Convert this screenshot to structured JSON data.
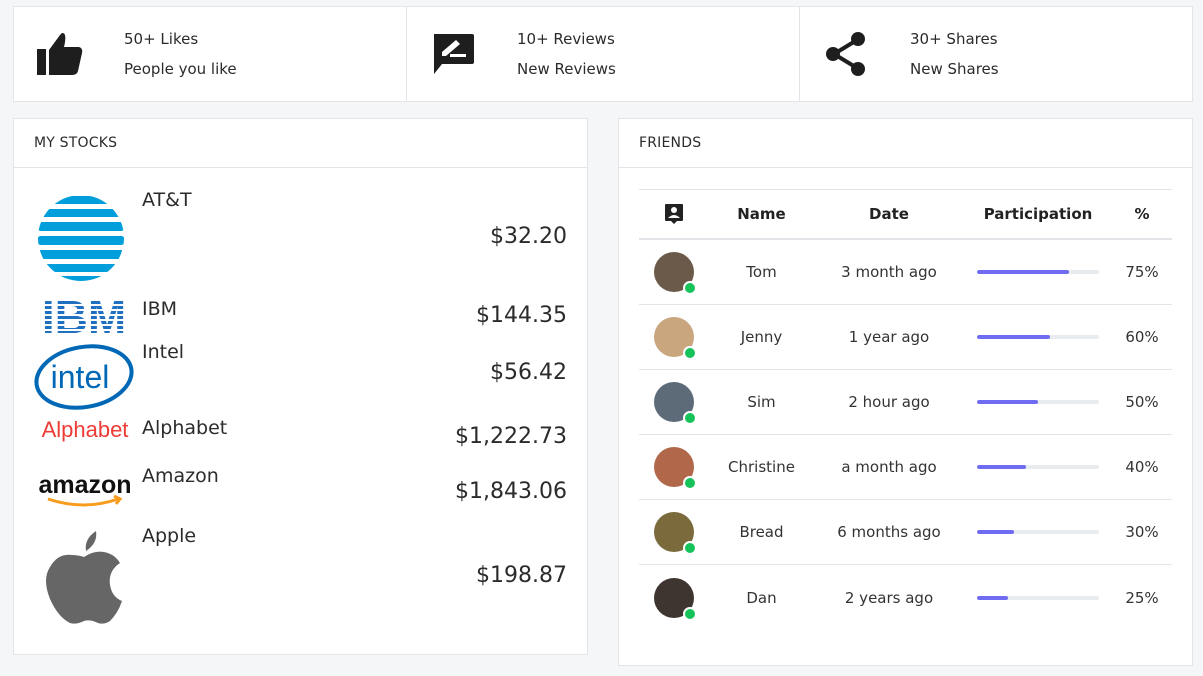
{
  "stats": [
    {
      "icon": "thumbs-up-icon",
      "title": "50+ Likes",
      "subtitle": "People you like"
    },
    {
      "icon": "review-icon",
      "title": "10+ Reviews",
      "subtitle": "New Reviews"
    },
    {
      "icon": "share-icon",
      "title": "30+ Shares",
      "subtitle": "New Shares"
    }
  ],
  "stocks": {
    "title": "MY STOCKS",
    "items": [
      {
        "name": "AT&T",
        "price": "$32.20",
        "logo": "att-logo",
        "logo_color": "#009fdb"
      },
      {
        "name": "IBM",
        "price": "$144.35",
        "logo": "ibm-logo",
        "logo_text": "IBM",
        "logo_color": "#1f70c1"
      },
      {
        "name": "Intel",
        "price": "$56.42",
        "logo": "intel-logo",
        "logo_text": "intel",
        "logo_color": "#0068b5"
      },
      {
        "name": "Alphabet",
        "price": "$1,222.73",
        "logo": "alphabet-logo",
        "logo_text": "Alphabet",
        "logo_color": "#ef3b36"
      },
      {
        "name": "Amazon",
        "price": "$1,843.06",
        "logo": "amazon-logo",
        "logo_text": "amazon",
        "logo_color": "#111111"
      },
      {
        "name": "Apple",
        "price": "$198.87",
        "logo": "apple-logo",
        "logo_color": "#666666"
      }
    ]
  },
  "friends": {
    "title": "FRIENDS",
    "headers": {
      "icon": "contact-icon",
      "name": "Name",
      "date": "Date",
      "participation": "Participation",
      "percent": "%"
    },
    "rows": [
      {
        "name": "Tom",
        "date": "3 month ago",
        "participation": 0.75,
        "percent": "75%",
        "avatar_color": "#6b5a4a"
      },
      {
        "name": "Jenny",
        "date": "1 year ago",
        "participation": 0.6,
        "percent": "60%",
        "avatar_color": "#c9a67e"
      },
      {
        "name": "Sim",
        "date": "2 hour ago",
        "participation": 0.5,
        "percent": "50%",
        "avatar_color": "#5d6b78"
      },
      {
        "name": "Christine",
        "date": "a month ago",
        "participation": 0.4,
        "percent": "40%",
        "avatar_color": "#b0674a"
      },
      {
        "name": "Bread",
        "date": "6 months ago",
        "participation": 0.3,
        "percent": "30%",
        "avatar_color": "#7a6a3c"
      },
      {
        "name": "Dan",
        "date": "2 years ago",
        "participation": 0.25,
        "percent": "25%",
        "avatar_color": "#3e3530"
      }
    ]
  },
  "colors": {
    "progress": "#6f6bf2",
    "online": "#16c35a",
    "border": "#e2e4e8"
  }
}
